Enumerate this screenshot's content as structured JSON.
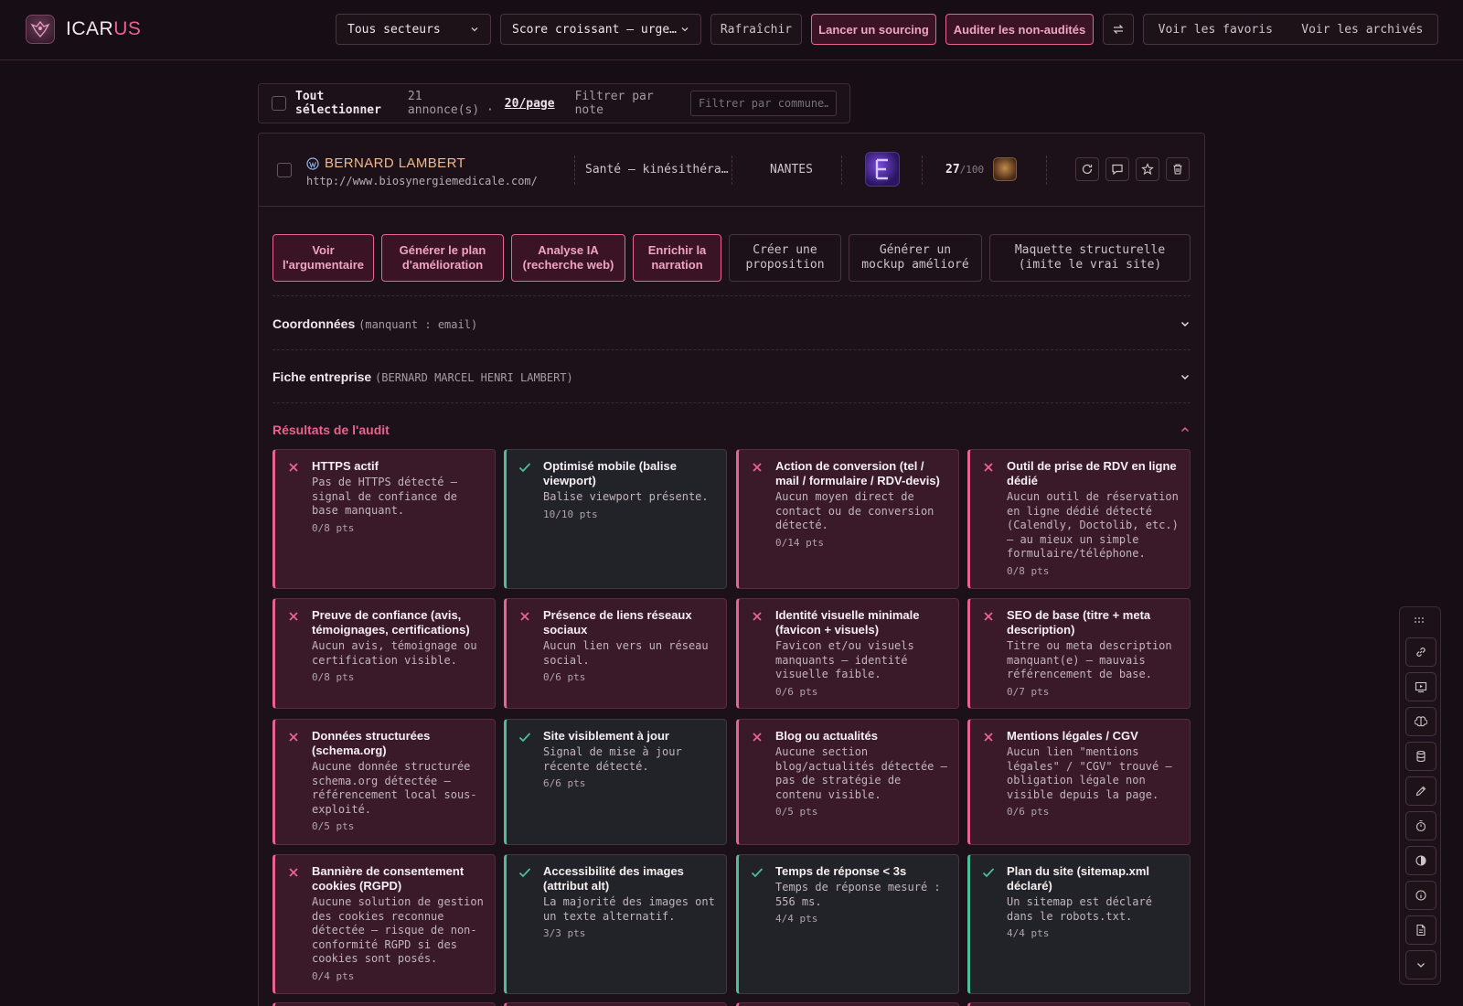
{
  "header": {
    "logo_text_a": "ICAR",
    "logo_text_b": "US",
    "sector_select": "Tous secteurs",
    "sort_select": "Score croissant — urge…",
    "refresh_label": "Rafraîchir",
    "sourcing_label": "Lancer un sourcing",
    "audit_label": "Auditer les non-audités",
    "favorites_label": "Voir les favoris",
    "archived_label": "Voir les archivés"
  },
  "filterbar": {
    "select_all": "Tout sélectionner",
    "count": "21 annonce(s) ·",
    "per_page": "20/page",
    "filter_note": "Filtrer par note",
    "commune_placeholder": "Filtrer par commune…"
  },
  "listing": {
    "name": "BERNARD LAMBERT",
    "url": "http://www.biosynergiemedicale.com/",
    "sector": "Santé — kinésithéra…",
    "city": "NANTES",
    "score": "27",
    "score_max": "/100"
  },
  "actions": [
    {
      "label": "Voir l'argumentaire"
    },
    {
      "label": "Générer le plan d'amélioration"
    },
    {
      "label": "Analyse IA (recherche web)"
    },
    {
      "label": "Enrichir la narration"
    },
    {
      "label": "Créer une proposition"
    },
    {
      "label": "Générer un mockup amélioré"
    },
    {
      "label": "Maquette structurelle (imite le vrai site)"
    }
  ],
  "sections": {
    "coords_title": "Coordonnées",
    "coords_sub": "(manquant : email)",
    "fiche_title": "Fiche entreprise",
    "fiche_sub": "(BERNARD MARCEL HENRI LAMBERT)",
    "audit_title": "Résultats de l'audit"
  },
  "audit_items": [
    {
      "status": "fail",
      "title": "HTTPS actif",
      "desc": "Pas de HTTPS détecté — signal de confiance de base manquant.",
      "pts": "0/8 pts"
    },
    {
      "status": "pass",
      "title": "Optimisé mobile (balise viewport)",
      "desc": "Balise viewport présente.",
      "pts": "10/10 pts"
    },
    {
      "status": "fail",
      "title": "Action de conversion (tel / mail / formulaire / RDV-devis)",
      "desc": "Aucun moyen direct de contact ou de conversion détecté.",
      "pts": "0/14 pts"
    },
    {
      "status": "fail",
      "title": "Outil de prise de RDV en ligne dédié",
      "desc": "Aucun outil de réservation en ligne dédié détecté (Calendly, Doctolib, etc.) — au mieux un simple formulaire/téléphone.",
      "pts": "0/8 pts"
    },
    {
      "status": "fail",
      "title": "Preuve de confiance (avis, témoignages, certifications)",
      "desc": "Aucun avis, témoignage ou certification visible.",
      "pts": "0/8 pts"
    },
    {
      "status": "fail",
      "title": "Présence de liens réseaux sociaux",
      "desc": "Aucun lien vers un réseau social.",
      "pts": "0/6 pts"
    },
    {
      "status": "fail",
      "title": "Identité visuelle minimale (favicon + visuels)",
      "desc": "Favicon et/ou visuels manquants — identité visuelle faible.",
      "pts": "0/6 pts"
    },
    {
      "status": "fail",
      "title": "SEO de base (titre + meta description)",
      "desc": "Titre ou meta description manquant(e) — mauvais référencement de base.",
      "pts": "0/7 pts"
    },
    {
      "status": "fail",
      "title": "Données structurées (schema.org)",
      "desc": "Aucune donnée structurée schema.org détectée — référencement local sous-exploité.",
      "pts": "0/5 pts"
    },
    {
      "status": "pass",
      "title": "Site visiblement à jour",
      "desc": "Signal de mise à jour récente détecté.",
      "pts": "6/6 pts"
    },
    {
      "status": "fail",
      "title": "Blog ou actualités",
      "desc": "Aucune section blog/actualités détectée — pas de stratégie de contenu visible.",
      "pts": "0/5 pts"
    },
    {
      "status": "fail",
      "title": "Mentions légales / CGV",
      "desc": "Aucun lien \"mentions légales\" / \"CGV\" trouvé — obligation légale non visible depuis la page.",
      "pts": "0/6 pts"
    },
    {
      "status": "fail",
      "title": "Bannière de consentement cookies (RGPD)",
      "desc": "Aucune solution de gestion des cookies reconnue détectée — risque de non-conformité RGPD si des cookies sont posés.",
      "pts": "0/4 pts"
    },
    {
      "status": "pass",
      "title": "Accessibilité des images (attribut alt)",
      "desc": "La majorité des images ont un texte alternatif.",
      "pts": "3/3 pts"
    },
    {
      "status": "pass",
      "title": "Temps de réponse < 3s",
      "desc": "Temps de réponse mesuré : 556 ms.",
      "pts": "4/4 pts"
    },
    {
      "status": "pass",
      "title": "Plan du site (sitemap.xml déclaré)",
      "desc": "Un sitemap est déclaré dans le robots.txt.",
      "pts": "4/4 pts"
    }
  ],
  "colors": {
    "accent": "#e8638f",
    "pass": "#4fbd97",
    "background": "#170d14"
  },
  "sidebar_icons": [
    "grip-icon",
    "link-icon",
    "play-icon",
    "brain-icon",
    "database-icon",
    "pen-icon",
    "timer-icon",
    "contrast-icon",
    "info-icon",
    "document-icon",
    "chevron-down-icon"
  ]
}
